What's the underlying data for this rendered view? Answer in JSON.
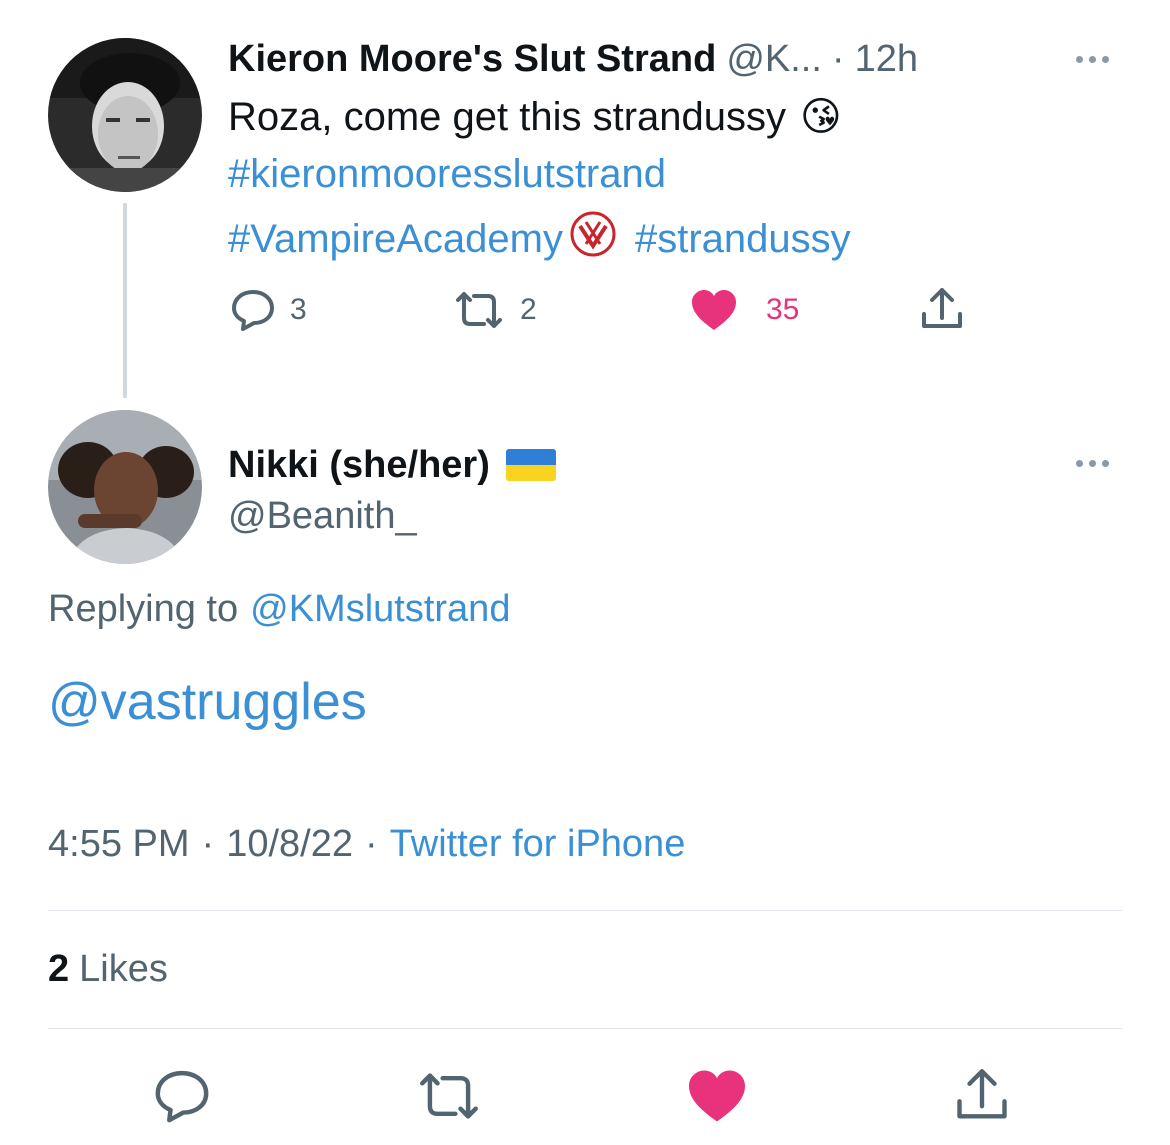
{
  "tweet1": {
    "display_name": "Kieron Moore's Slut Strand",
    "handle": "@K...",
    "separator": "·",
    "time": "12h",
    "text_prefix": "Roza, come get this strandussy",
    "emoji": "😘",
    "hashtag1": "#kieronmooresslutstrand",
    "hashtag2": "#VampireAcademy",
    "hashtag3": "#strandussy",
    "reply_count": "3",
    "retweet_count": "2",
    "like_count": "35"
  },
  "tweet2": {
    "display_name": "Nikki (she/her)",
    "handle": "@Beanith_",
    "replying_label": "Replying to",
    "replying_handle": "@KMslutstrand",
    "text": "@vastruggles",
    "time": "4:55 PM",
    "dot1": "·",
    "date": "10/8/22",
    "dot2": "·",
    "source": "Twitter for iPhone",
    "likes_count": "2",
    "likes_label": "Likes"
  },
  "colors": {
    "link": "#3b8fd4",
    "like": "#e8337c",
    "muted": "#536471"
  },
  "icons": {
    "reply": "reply-icon",
    "retweet": "retweet-icon",
    "like": "heart-icon",
    "share": "share-icon",
    "more": "more-icon",
    "flag": "ukraine-flag-icon"
  }
}
